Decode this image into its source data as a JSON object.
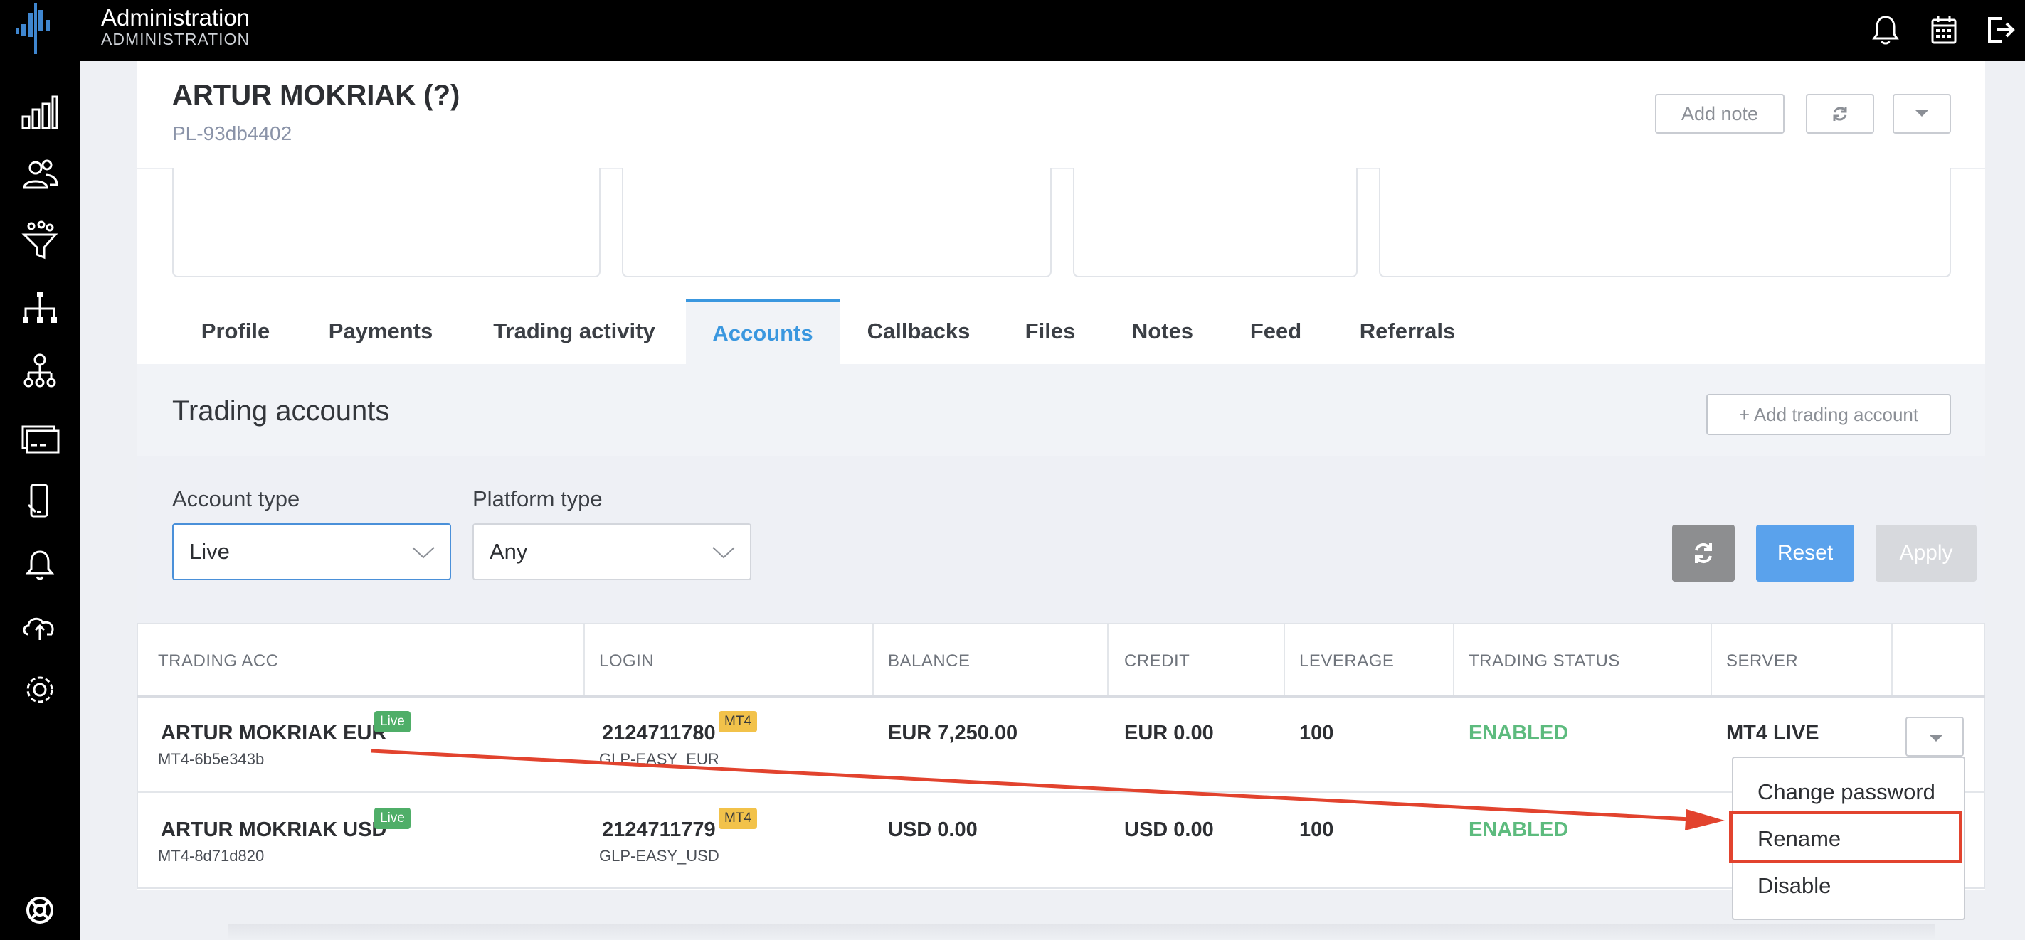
{
  "app": {
    "title": "Administration",
    "subtitle": "ADMINISTRATION"
  },
  "client": {
    "name": "ARTUR MOKRIAK (?)",
    "id": "PL-93db4402"
  },
  "header_buttons": {
    "add_note": "Add note"
  },
  "tabs": [
    {
      "label": "Profile"
    },
    {
      "label": "Payments"
    },
    {
      "label": "Trading activity"
    },
    {
      "label": "Accounts",
      "active": true
    },
    {
      "label": "Callbacks"
    },
    {
      "label": "Files"
    },
    {
      "label": "Notes"
    },
    {
      "label": "Feed"
    },
    {
      "label": "Referrals"
    }
  ],
  "section": {
    "title": "Trading accounts",
    "add_button": "+ Add trading account"
  },
  "filters": {
    "account_type": {
      "label": "Account type",
      "value": "Live"
    },
    "platform_type": {
      "label": "Platform type",
      "value": "Any"
    },
    "reset": "Reset",
    "apply": "Apply"
  },
  "table": {
    "headers": [
      "TRADING ACC",
      "LOGIN",
      "BALANCE",
      "CREDIT",
      "LEVERAGE",
      "TRADING STATUS",
      "SERVER"
    ],
    "rows": [
      {
        "name": "ARTUR MOKRIAK EUR",
        "badge": "Live",
        "acc_id": "MT4-6b5e343b",
        "login": "2124711780",
        "platform": "MT4",
        "group": "GLP-EASY_EUR",
        "balance": "EUR 7,250.00",
        "credit": "EUR 0.00",
        "leverage": "100",
        "status": "ENABLED",
        "server": "MT4 LIVE"
      },
      {
        "name": "ARTUR MOKRIAK USD",
        "badge": "Live",
        "acc_id": "MT4-8d71d820",
        "login": "2124711779",
        "platform": "MT4",
        "group": "GLP-EASY_USD",
        "balance": "USD 0.00",
        "credit": "USD 0.00",
        "leverage": "100",
        "status": "ENABLED",
        "server": ""
      }
    ]
  },
  "row_menu": {
    "items": [
      "Change password",
      "Rename",
      "Disable"
    ],
    "highlighted": "Rename"
  },
  "icons": {
    "top": [
      "bell-icon",
      "calendar-icon",
      "logout-icon"
    ],
    "sidebar": [
      "dashboard-icon",
      "clients-icon",
      "funnel-icon",
      "hierarchy-icon",
      "team-icon",
      "payments-icon",
      "mobile-icon",
      "notifications-icon",
      "cloud-sync-icon",
      "settings-icon",
      "support-icon"
    ]
  },
  "colors": {
    "accent": "#3a97df",
    "status_enabled": "#5dbb7e",
    "annotation": "#e2432e",
    "badge_live": "#4fae68",
    "badge_mt4": "#f2c24a"
  }
}
